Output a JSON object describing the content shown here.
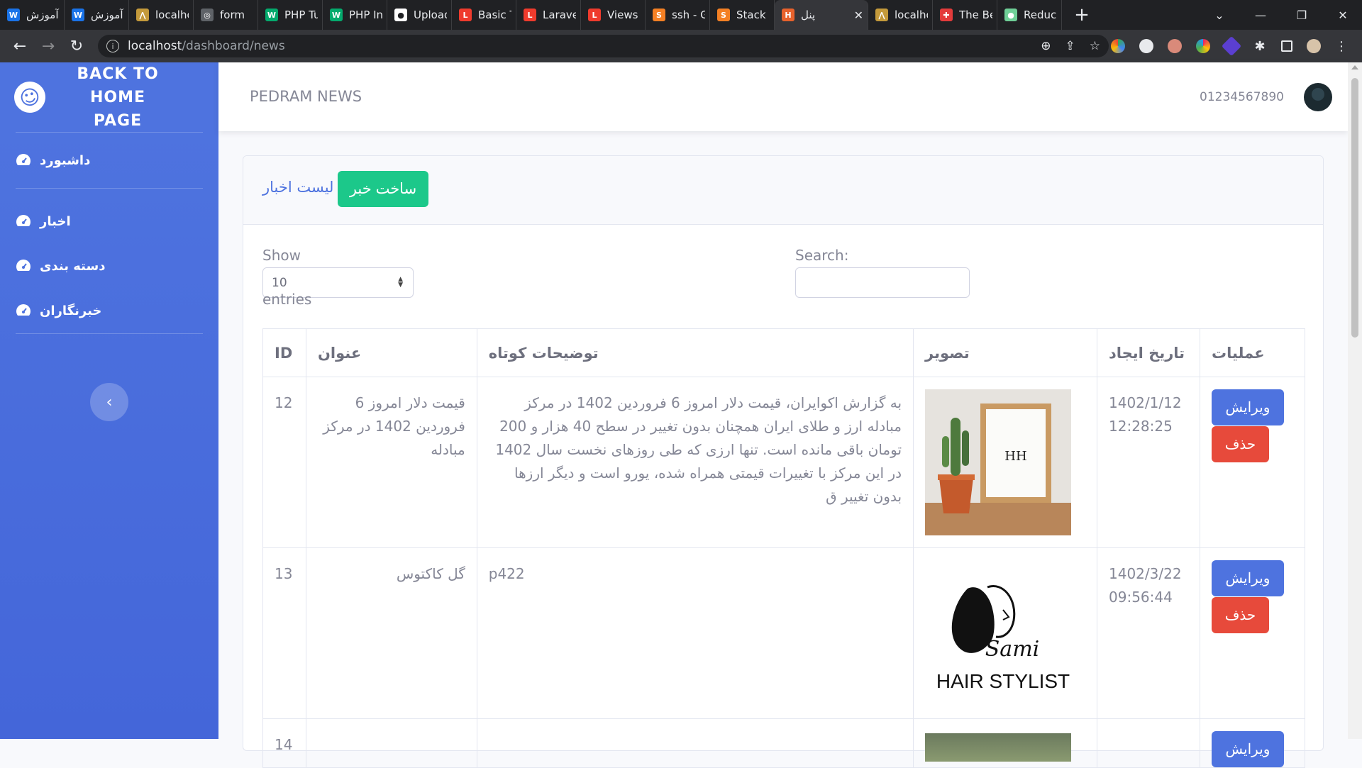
{
  "browser": {
    "tabs": [
      {
        "label": "آموزش",
        "fav_color": "#1a73e8",
        "fav_text": "W"
      },
      {
        "label": "آموزش",
        "fav_color": "#1a73e8",
        "fav_text": "W"
      },
      {
        "label": "localho",
        "fav_color": "#c49a3b",
        "fav_text": "⋀"
      },
      {
        "label": "form",
        "fav_color": "#5f6368",
        "fav_text": "◎"
      },
      {
        "label": "PHP Tu",
        "fav_color": "#04aa6d",
        "fav_text": "W"
      },
      {
        "label": "PHP Int",
        "fav_color": "#04aa6d",
        "fav_text": "W"
      },
      {
        "label": "Upload",
        "fav_color": "#ffffff",
        "fav_text": "●"
      },
      {
        "label": "Basic Ta",
        "fav_color": "#ef3b2d",
        "fav_text": "L"
      },
      {
        "label": "Laravel",
        "fav_color": "#ef3b2d",
        "fav_text": "L"
      },
      {
        "label": "Views -",
        "fav_color": "#ef3b2d",
        "fav_text": "L"
      },
      {
        "label": "ssh - G",
        "fav_color": "#f48024",
        "fav_text": "S"
      },
      {
        "label": "Stack C",
        "fav_color": "#f48024",
        "fav_text": "S"
      },
      {
        "label": "پنل",
        "fav_color": "#e8622c",
        "fav_text": "H",
        "active": true
      },
      {
        "label": "localho",
        "fav_color": "#c49a3b",
        "fav_text": "⋀"
      },
      {
        "label": "The Be",
        "fav_color": "#e33b3b",
        "fav_text": "✚"
      },
      {
        "label": "Reduce",
        "fav_color": "#6fcf97",
        "fav_text": "●"
      }
    ],
    "url_host": "localhost",
    "url_path": "/dashboard/news"
  },
  "sidebar": {
    "brand_line1": "BACK TO",
    "brand_line2": "HOME PAGE",
    "items": [
      {
        "label": "داشبورد",
        "name": "dashboard"
      },
      {
        "label": "اخبار",
        "name": "news"
      },
      {
        "label": "دسته بندی",
        "name": "categories"
      },
      {
        "label": "خبرنگاران",
        "name": "reporters"
      }
    ],
    "toggle_icon": "‹"
  },
  "topbar": {
    "title": "PEDRAM NEWS",
    "user_phone": "01234567890"
  },
  "card": {
    "title": "لیست اخبار",
    "create_label": "ساخت خبر"
  },
  "datatable": {
    "show_label": "Show",
    "entries_value": "10",
    "entries_label": "entries",
    "search_label": "Search:",
    "search_value": ""
  },
  "table": {
    "headers": {
      "id": "ID",
      "title": "عنوان",
      "summary": "توضیحات کوتاه",
      "image": "تصویر",
      "created": "تاریخ ایجاد",
      "actions": "عملیات"
    },
    "edit_label": "ویرایش",
    "delete_label": "حذف",
    "rows": [
      {
        "id": "12",
        "title": "قیمت دلار امروز 6 فروردین 1402 در مرکز مبادله",
        "summary": "به گزارش اکوایران، قیمت دلار امروز 6 فروردین 1402 در مرکز مبادله ارز و طلای ایران همچنان بدون تغییر در سطح 40 هزار و 200 تومان باقی مانده است. تنها ارزی که طی روزهای نخست سال 1402 در این مرکز با تغییرات قیمتی همراه شده، یورو است و دیگر ارزها بدون تغییر ق",
        "image": "cactus-frame-photo",
        "date": "1402/1/12",
        "time": "12:28:25"
      },
      {
        "id": "13",
        "title": "گل کاکتوس",
        "summary": "p422",
        "image": "hair-stylist-logo",
        "logo_script": "Sami",
        "logo_caption": "HAIR STYLIST",
        "date": "1402/3/22",
        "time": "09:56:44"
      },
      {
        "id": "14",
        "title": "",
        "summary": "",
        "image": "street-photo",
        "date": "",
        "time": ""
      }
    ]
  }
}
